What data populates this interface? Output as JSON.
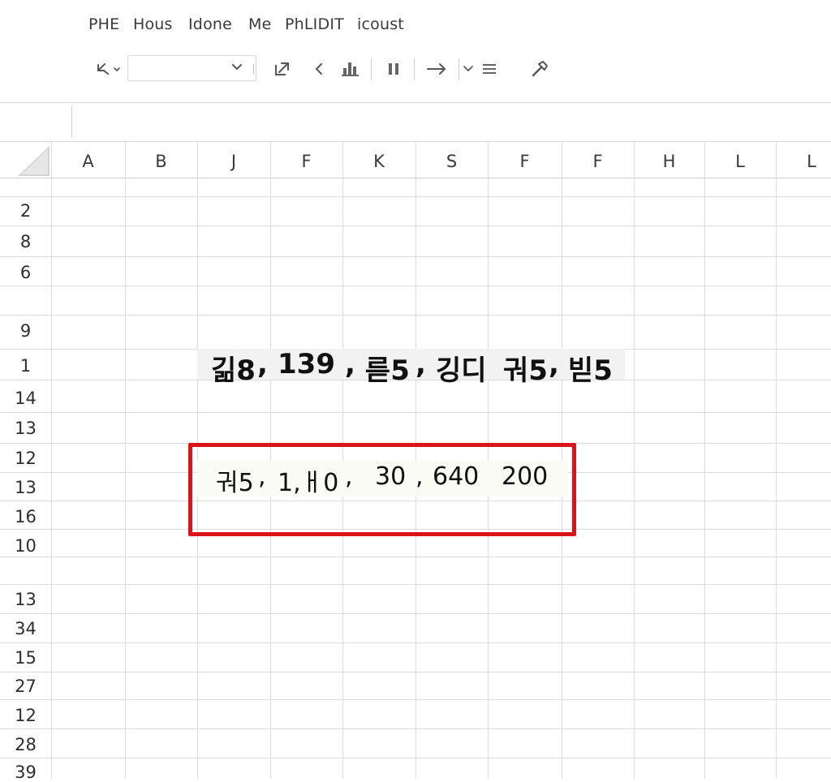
{
  "menu": {
    "items": [
      {
        "label": "PHE"
      },
      {
        "label": "Hous"
      },
      {
        "label": "Idone"
      },
      {
        "label": "Me"
      },
      {
        "label": "PhLIDIT"
      },
      {
        "label": "icoust"
      }
    ]
  },
  "toolbar": {
    "tools": [
      {
        "icon": "back-arrow-dropdown-icon"
      },
      {
        "icon": "font-combo-dropdown"
      },
      {
        "icon": "external-link-icon"
      },
      {
        "icon": "chevron-left-icon"
      },
      {
        "icon": "bar-chart-icon"
      },
      {
        "icon": "pause-icon"
      },
      {
        "icon": "arrow-right-icon"
      },
      {
        "icon": "chevron-down-icon"
      },
      {
        "icon": "menu-lines-icon"
      },
      {
        "icon": "hammer-icon"
      }
    ],
    "font_combo_value": ""
  },
  "formula_bar": {
    "value": ""
  },
  "columns": [
    "A",
    "B",
    "J",
    "F",
    "K",
    "S",
    "F",
    "F",
    "H",
    "L",
    "L"
  ],
  "rows": [
    "2",
    "8",
    "6",
    "",
    "9",
    "1",
    "14",
    "13",
    "12",
    "13",
    "16",
    "10",
    "",
    "13",
    "34",
    "15",
    "27",
    "12",
    "28",
    "39"
  ],
  "cells": {
    "row1": [
      "긺8",
      ",",
      "139",
      ",",
      "륻5",
      ",",
      "깅디",
      "궈5",
      ",",
      "빋5"
    ],
    "row12": [
      "궈5",
      ",",
      "1,ㅐ0",
      ",",
      "30",
      ",",
      "640",
      "200"
    ]
  },
  "colors": {
    "highlight_border": "#d9151b",
    "grid_line": "#dcdcdc",
    "row1_fill": "#f2f2f2"
  }
}
